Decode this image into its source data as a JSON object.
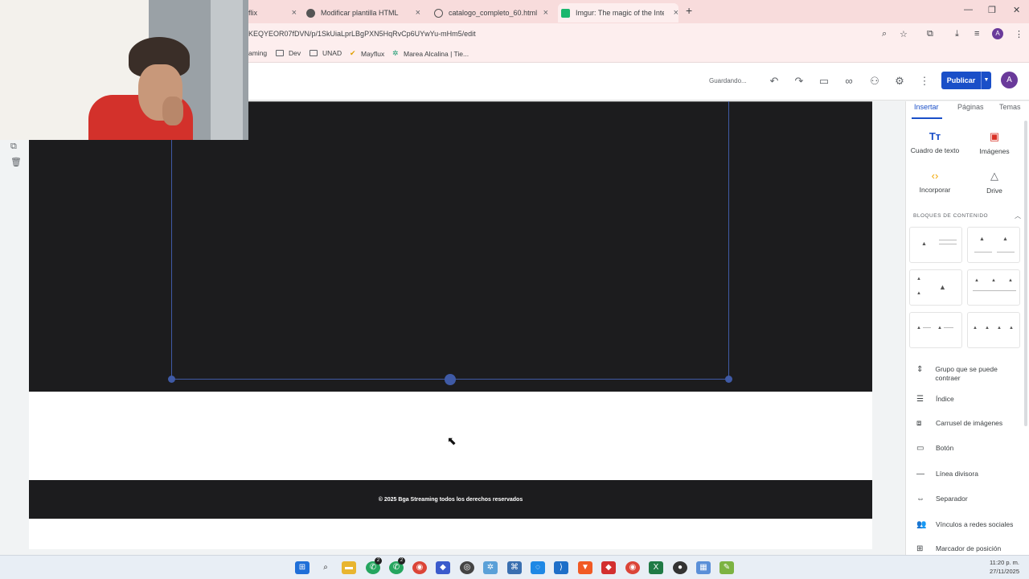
{
  "browser": {
    "tabs": [
      {
        "label": "flix"
      },
      {
        "label": "Modificar plantilla HTML"
      },
      {
        "label": "catalogo_completo_60.html"
      },
      {
        "label": "Imgur: The magic of the Interne"
      }
    ],
    "url": "KEQYEOR07fDVN/p/1SkUiaLprLBgPXN5HqRvCp6UYwYu-mHm5/edit",
    "profile_initial": "A",
    "bookmarks": [
      "aming",
      "Dev",
      "UNAD",
      "Mayflux",
      "Marea Alcalina | Tie..."
    ]
  },
  "toolbar": {
    "status": "Guardando...",
    "publish_label": "Publicar",
    "user_initial": "A"
  },
  "page": {
    "footer_text": "© 2025 Bga Streaming todos los derechos reservados"
  },
  "panel": {
    "tabs": [
      "Insertar",
      "Páginas",
      "Temas"
    ],
    "active_tab": "Insertar",
    "tools": [
      {
        "label": "Cuadro de texto",
        "icon": "text-box-icon"
      },
      {
        "label": "Imágenes",
        "icon": "image-icon"
      },
      {
        "label": "Incorporar",
        "icon": "embed-icon"
      },
      {
        "label": "Drive",
        "icon": "drive-icon"
      }
    ],
    "blocks_title": "BLOQUES DE CONTENIDO",
    "items": [
      {
        "label": "Grupo que se puede contraer",
        "icon": "collapsible-icon"
      },
      {
        "label": "Índice",
        "icon": "toc-icon"
      },
      {
        "label": "Carrusel de imágenes",
        "icon": "carousel-icon"
      },
      {
        "label": "Botón",
        "icon": "button-icon"
      },
      {
        "label": "Línea divisora",
        "icon": "divider-icon"
      },
      {
        "label": "Separador",
        "icon": "spacer-icon"
      },
      {
        "label": "Vínculos a redes sociales",
        "icon": "social-icon"
      },
      {
        "label": "Marcador de posición",
        "icon": "placeholder-icon"
      }
    ]
  },
  "taskbar": {
    "time": "11:20 p. m.",
    "date": "27/11/2025",
    "badges": [
      "2",
      "2"
    ]
  },
  "colors": {
    "accent": "#1a4fc8",
    "dark_section": "#1c1c1e",
    "tabstrip": "#f8dcdc"
  }
}
